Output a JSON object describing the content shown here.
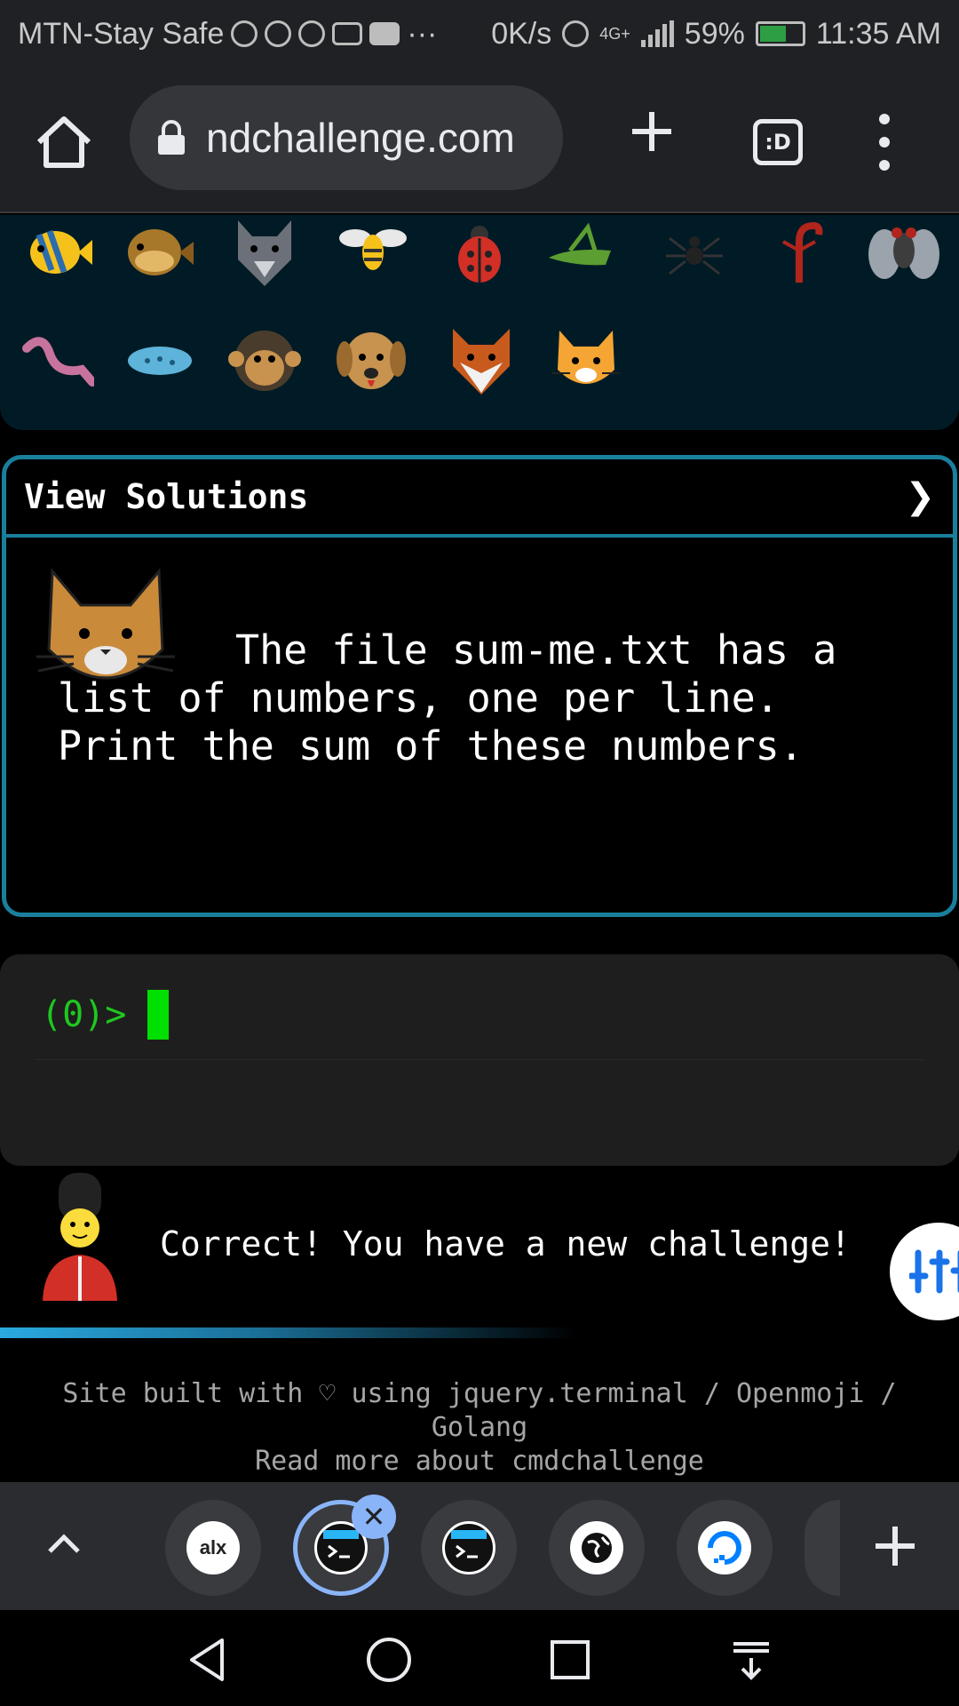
{
  "status_bar": {
    "carrier": "MTN-Stay Safe",
    "overflow": "···",
    "net_speed": "0K/s",
    "network_type": "4G+",
    "battery": "59%",
    "battery_level": 0.59,
    "time": "11:35 AM"
  },
  "browser": {
    "url": "ndchallenge.com",
    "tab_switcher_label": ":D",
    "icons": {
      "home": "home-icon",
      "lock": "lock-icon",
      "new_tab": "plus-icon",
      "tabs": "tab-switcher-icon",
      "menu": "more-vert-icon"
    }
  },
  "emoji_panel": {
    "row1": [
      "fish",
      "pufferfish",
      "wolf",
      "bee",
      "ladybug",
      "grasshopper",
      "spider",
      "scorpion",
      "fly"
    ],
    "row2": [
      "worm",
      "microbe",
      "monkey",
      "dog",
      "fox",
      "cat"
    ]
  },
  "solutions": {
    "title": "View Solutions",
    "arrow": "❯",
    "challenge_text": "The file sum-me.txt has a list of numbers, one per line. Print the sum of these numbers."
  },
  "terminal": {
    "prompt": "(0)>"
  },
  "message": {
    "text": "Correct! You have a new challenge!"
  },
  "footer": {
    "line1": "Site built with ♡ using jquery.terminal / Openmoji /",
    "line2": "Golang",
    "line3": "Read more about cmdchallenge"
  },
  "tab_strip": {
    "tabs": [
      {
        "label": "alx",
        "icon": "alx-icon"
      },
      {
        "label": "",
        "icon": "terminal-icon",
        "active": true
      },
      {
        "label": "",
        "icon": "terminal-icon"
      },
      {
        "label": "",
        "icon": "globe-icon"
      },
      {
        "label": "",
        "icon": "digitalocean-icon"
      }
    ],
    "close_label": "✕"
  },
  "colors": {
    "accent": "#1a7f9c",
    "prompt": "#1ec81e",
    "panel_bg": "#001b25",
    "terminal_bg": "#1e1e1e"
  }
}
